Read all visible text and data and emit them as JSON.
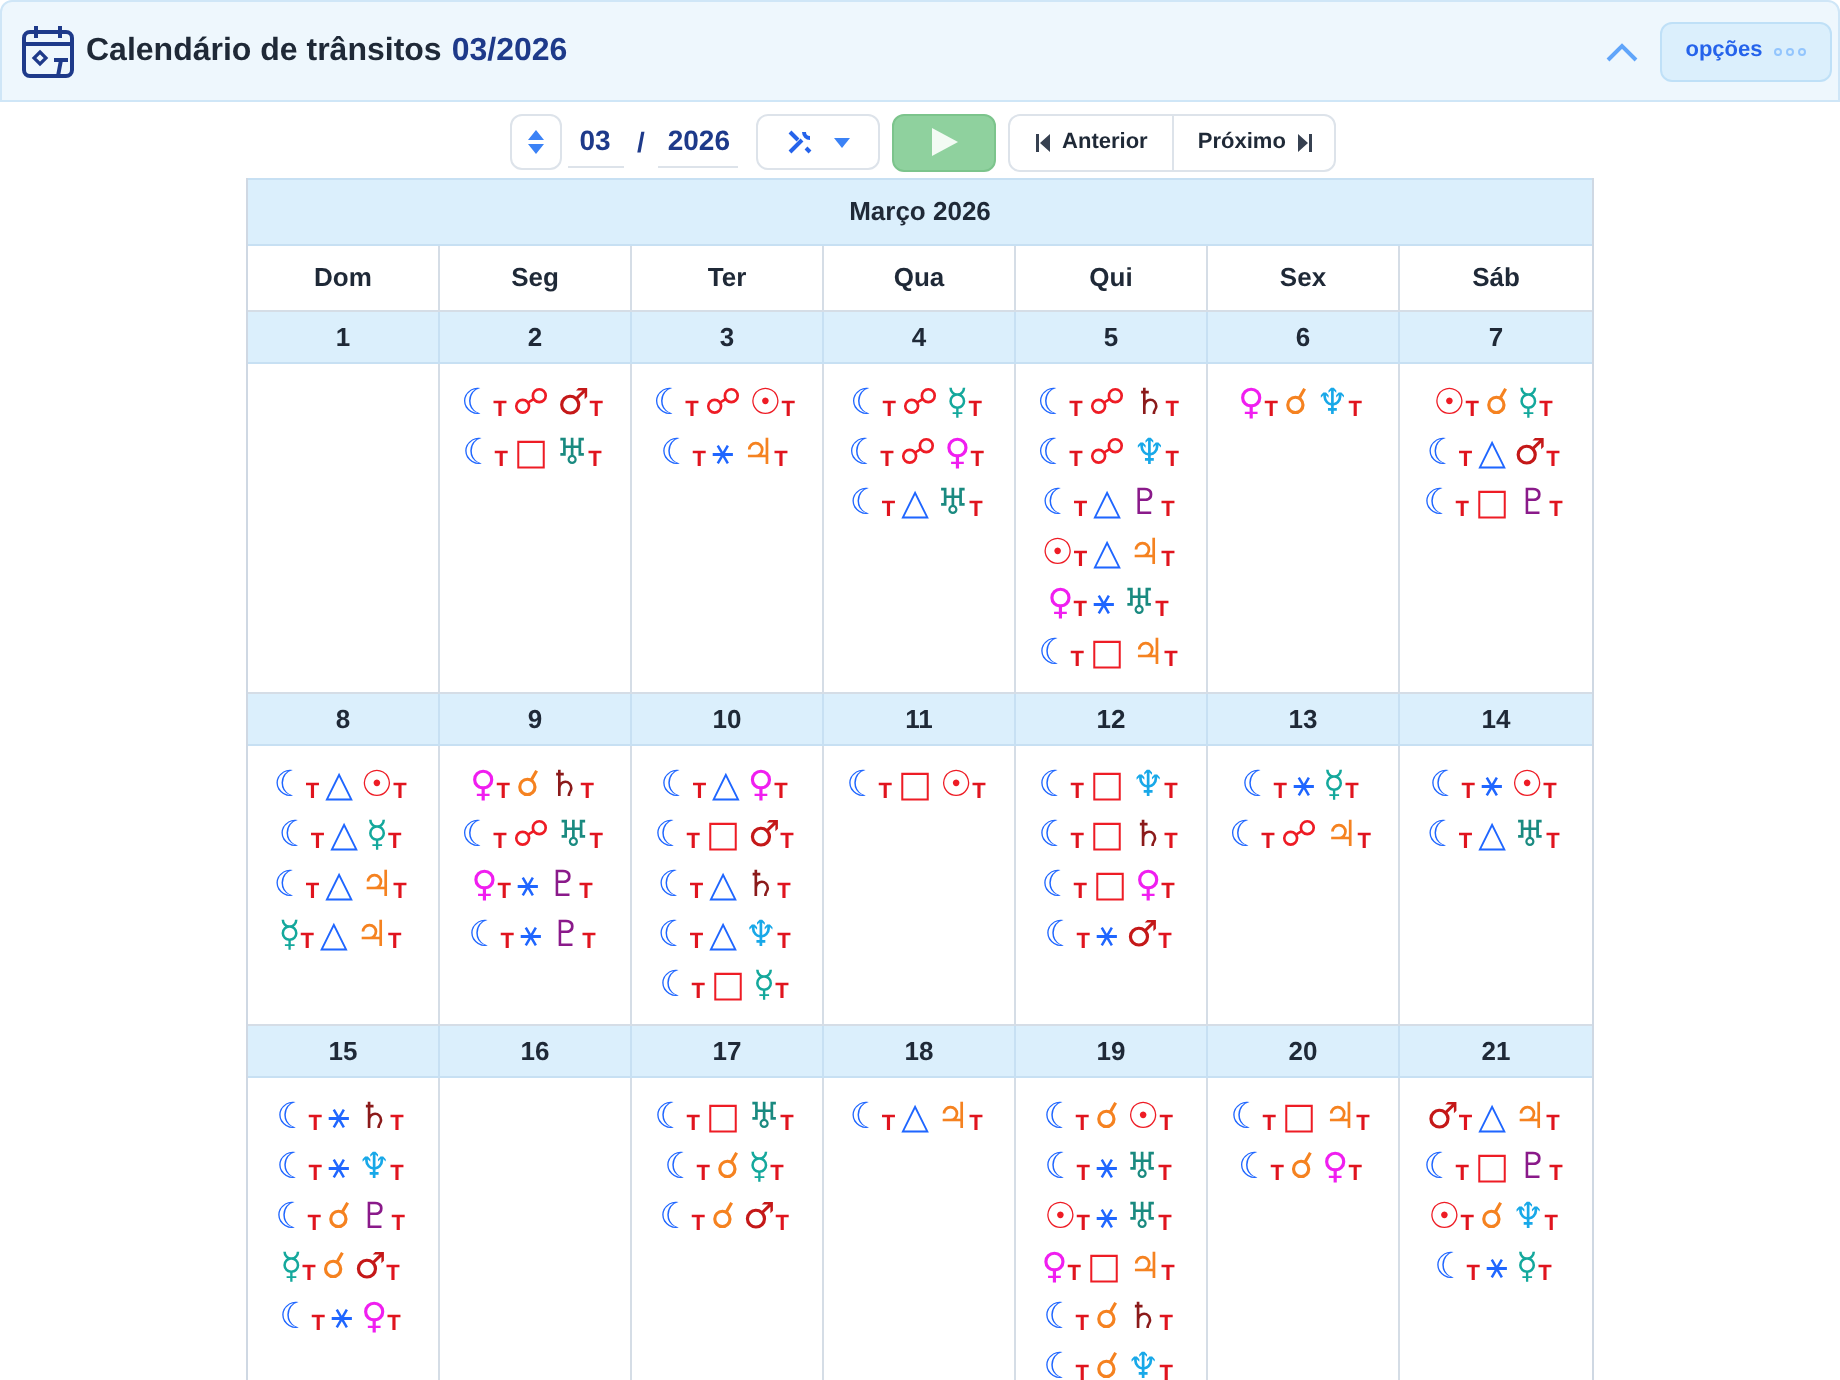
{
  "header": {
    "title": "Calendário de trânsitos",
    "period": "03/2026",
    "options": "opções"
  },
  "toolbar": {
    "month": "03",
    "separator": "/",
    "year": "2026",
    "previous": "Anterior",
    "next": "Próximo"
  },
  "calendar": {
    "title": "Março 2026",
    "weekdays": [
      "Dom",
      "Seg",
      "Ter",
      "Qua",
      "Qui",
      "Sex",
      "Sáb"
    ],
    "weeks": [
      {
        "days": [
          {
            "date": "1"
          },
          {
            "date": "2",
            "aspects": [
              {
                "from": {
                  "glyph": "☾",
                  "color": "#1f66ff"
                },
                "from_mark": "T",
                "aspect": {
                  "glyph": "☍",
                  "color": "#ee1c25"
                },
                "to": {
                  "glyph": "♂",
                  "color": "#c41818"
                },
                "to_mark": "T"
              },
              {
                "from": {
                  "glyph": "☾",
                  "color": "#1f66ff"
                },
                "from_mark": "T",
                "aspect": {
                  "glyph": "□",
                  "color": "#ee1c25"
                },
                "to": {
                  "glyph": "♅",
                  "color": "#1a8a80"
                },
                "to_mark": "T"
              }
            ]
          },
          {
            "date": "3",
            "aspects": [
              {
                "from": {
                  "glyph": "☾",
                  "color": "#1f66ff"
                },
                "from_mark": "T",
                "aspect": {
                  "glyph": "☍",
                  "color": "#ee1c25"
                },
                "to": {
                  "glyph": "☉",
                  "color": "#ee1c25"
                },
                "to_mark": "T"
              },
              {
                "from": {
                  "glyph": "☾",
                  "color": "#1f66ff"
                },
                "from_mark": "T",
                "aspect": {
                  "glyph": "⚹",
                  "color": "#1f66ff"
                },
                "to": {
                  "glyph": "♃",
                  "color": "#f58220"
                },
                "to_mark": "T"
              }
            ]
          },
          {
            "date": "4",
            "aspects": [
              {
                "from": {
                  "glyph": "☾",
                  "color": "#1f66ff"
                },
                "from_mark": "T",
                "aspect": {
                  "glyph": "☍",
                  "color": "#ee1c25"
                },
                "to": {
                  "glyph": "☿",
                  "color": "#14a89c"
                },
                "to_mark": "T"
              },
              {
                "from": {
                  "glyph": "☾",
                  "color": "#1f66ff"
                },
                "from_mark": "T",
                "aspect": {
                  "glyph": "☍",
                  "color": "#ee1c25"
                },
                "to": {
                  "glyph": "♀",
                  "color": "#f01ef0"
                },
                "to_mark": "T"
              },
              {
                "from": {
                  "glyph": "☾",
                  "color": "#1f66ff"
                },
                "from_mark": "T",
                "aspect": {
                  "glyph": "△",
                  "color": "#1f66ff"
                },
                "to": {
                  "glyph": "♅",
                  "color": "#1a8a80"
                },
                "to_mark": "T"
              }
            ]
          },
          {
            "date": "5",
            "aspects": [
              {
                "from": {
                  "glyph": "☾",
                  "color": "#1f66ff"
                },
                "from_mark": "T",
                "aspect": {
                  "glyph": "☍",
                  "color": "#ee1c25"
                },
                "to": {
                  "glyph": "♄",
                  "color": "#8b1a1a"
                },
                "to_mark": "T"
              },
              {
                "from": {
                  "glyph": "☾",
                  "color": "#1f66ff"
                },
                "from_mark": "T",
                "aspect": {
                  "glyph": "☍",
                  "color": "#ee1c25"
                },
                "to": {
                  "glyph": "♆",
                  "color": "#18a8e8"
                },
                "to_mark": "T"
              },
              {
                "from": {
                  "glyph": "☾",
                  "color": "#1f66ff"
                },
                "from_mark": "T",
                "aspect": {
                  "glyph": "△",
                  "color": "#1f66ff"
                },
                "to": {
                  "glyph": "♇",
                  "color": "#8a1a8a"
                },
                "to_mark": "T"
              },
              {
                "from": {
                  "glyph": "☉",
                  "color": "#ee1c25"
                },
                "from_mark": "T",
                "aspect": {
                  "glyph": "△",
                  "color": "#1f66ff"
                },
                "to": {
                  "glyph": "♃",
                  "color": "#f58220"
                },
                "to_mark": "T"
              },
              {
                "from": {
                  "glyph": "♀",
                  "color": "#f01ef0"
                },
                "from_mark": "T",
                "aspect": {
                  "glyph": "⚹",
                  "color": "#1f66ff"
                },
                "to": {
                  "glyph": "♅",
                  "color": "#1a8a80"
                },
                "to_mark": "T"
              },
              {
                "from": {
                  "glyph": "☾",
                  "color": "#1f66ff"
                },
                "from_mark": "T",
                "aspect": {
                  "glyph": "□",
                  "color": "#ee1c25"
                },
                "to": {
                  "glyph": "♃",
                  "color": "#f58220"
                },
                "to_mark": "T"
              }
            ]
          },
          {
            "date": "6",
            "aspects": [
              {
                "from": {
                  "glyph": "♀",
                  "color": "#f01ef0"
                },
                "from_mark": "T",
                "aspect": {
                  "glyph": "☌",
                  "color": "#f58220"
                },
                "to": {
                  "glyph": "♆",
                  "color": "#18a8e8"
                },
                "to_mark": "T"
              }
            ]
          },
          {
            "date": "7",
            "aspects": [
              {
                "from": {
                  "glyph": "☉",
                  "color": "#ee1c25"
                },
                "from_mark": "T",
                "aspect": {
                  "glyph": "☌",
                  "color": "#f58220"
                },
                "to": {
                  "glyph": "☿",
                  "color": "#14a89c"
                },
                "to_mark": "T"
              },
              {
                "from": {
                  "glyph": "☾",
                  "color": "#1f66ff"
                },
                "from_mark": "T",
                "aspect": {
                  "glyph": "△",
                  "color": "#1f66ff"
                },
                "to": {
                  "glyph": "♂",
                  "color": "#c41818"
                },
                "to_mark": "T"
              },
              {
                "from": {
                  "glyph": "☾",
                  "color": "#1f66ff"
                },
                "from_mark": "T",
                "aspect": {
                  "glyph": "□",
                  "color": "#ee1c25"
                },
                "to": {
                  "glyph": "♇",
                  "color": "#8a1a8a"
                },
                "to_mark": "T"
              }
            ]
          }
        ]
      },
      {
        "days": [
          {
            "date": "8",
            "aspects": [
              {
                "from": {
                  "glyph": "☾",
                  "color": "#1f66ff"
                },
                "from_mark": "T",
                "aspect": {
                  "glyph": "△",
                  "color": "#1f66ff"
                },
                "to": {
                  "glyph": "☉",
                  "color": "#ee1c25"
                },
                "to_mark": "T"
              },
              {
                "from": {
                  "glyph": "☾",
                  "color": "#1f66ff"
                },
                "from_mark": "T",
                "aspect": {
                  "glyph": "△",
                  "color": "#1f66ff"
                },
                "to": {
                  "glyph": "☿",
                  "color": "#14a89c"
                },
                "to_mark": "T"
              },
              {
                "from": {
                  "glyph": "☾",
                  "color": "#1f66ff"
                },
                "from_mark": "T",
                "aspect": {
                  "glyph": "△",
                  "color": "#1f66ff"
                },
                "to": {
                  "glyph": "♃",
                  "color": "#f58220"
                },
                "to_mark": "T"
              },
              {
                "from": {
                  "glyph": "☿",
                  "color": "#14a89c"
                },
                "from_mark": "T",
                "aspect": {
                  "glyph": "△",
                  "color": "#1f66ff"
                },
                "to": {
                  "glyph": "♃",
                  "color": "#f58220"
                },
                "to_mark": "T"
              }
            ]
          },
          {
            "date": "9",
            "aspects": [
              {
                "from": {
                  "glyph": "♀",
                  "color": "#f01ef0"
                },
                "from_mark": "T",
                "aspect": {
                  "glyph": "☌",
                  "color": "#f58220"
                },
                "to": {
                  "glyph": "♄",
                  "color": "#8b1a1a"
                },
                "to_mark": "T"
              },
              {
                "from": {
                  "glyph": "☾",
                  "color": "#1f66ff"
                },
                "from_mark": "T",
                "aspect": {
                  "glyph": "☍",
                  "color": "#ee1c25"
                },
                "to": {
                  "glyph": "♅",
                  "color": "#1a8a80"
                },
                "to_mark": "T"
              },
              {
                "from": {
                  "glyph": "♀",
                  "color": "#f01ef0"
                },
                "from_mark": "T",
                "aspect": {
                  "glyph": "⚹",
                  "color": "#1f66ff"
                },
                "to": {
                  "glyph": "♇",
                  "color": "#8a1a8a"
                },
                "to_mark": "T"
              },
              {
                "from": {
                  "glyph": "☾",
                  "color": "#1f66ff"
                },
                "from_mark": "T",
                "aspect": {
                  "glyph": "⚹",
                  "color": "#1f66ff"
                },
                "to": {
                  "glyph": "♇",
                  "color": "#8a1a8a"
                },
                "to_mark": "T"
              }
            ]
          },
          {
            "date": "10",
            "aspects": [
              {
                "from": {
                  "glyph": "☾",
                  "color": "#1f66ff"
                },
                "from_mark": "T",
                "aspect": {
                  "glyph": "△",
                  "color": "#1f66ff"
                },
                "to": {
                  "glyph": "♀",
                  "color": "#f01ef0"
                },
                "to_mark": "T"
              },
              {
                "from": {
                  "glyph": "☾",
                  "color": "#1f66ff"
                },
                "from_mark": "T",
                "aspect": {
                  "glyph": "□",
                  "color": "#ee1c25"
                },
                "to": {
                  "glyph": "♂",
                  "color": "#c41818"
                },
                "to_mark": "T"
              },
              {
                "from": {
                  "glyph": "☾",
                  "color": "#1f66ff"
                },
                "from_mark": "T",
                "aspect": {
                  "glyph": "△",
                  "color": "#1f66ff"
                },
                "to": {
                  "glyph": "♄",
                  "color": "#8b1a1a"
                },
                "to_mark": "T"
              },
              {
                "from": {
                  "glyph": "☾",
                  "color": "#1f66ff"
                },
                "from_mark": "T",
                "aspect": {
                  "glyph": "△",
                  "color": "#1f66ff"
                },
                "to": {
                  "glyph": "♆",
                  "color": "#18a8e8"
                },
                "to_mark": "T"
              },
              {
                "from": {
                  "glyph": "☾",
                  "color": "#1f66ff"
                },
                "from_mark": "T",
                "aspect": {
                  "glyph": "□",
                  "color": "#ee1c25"
                },
                "to": {
                  "glyph": "☿",
                  "color": "#14a89c"
                },
                "to_mark": "T"
              }
            ]
          },
          {
            "date": "11",
            "aspects": [
              {
                "from": {
                  "glyph": "☾",
                  "color": "#1f66ff"
                },
                "from_mark": "T",
                "aspect": {
                  "glyph": "□",
                  "color": "#ee1c25"
                },
                "to": {
                  "glyph": "☉",
                  "color": "#ee1c25"
                },
                "to_mark": "T"
              }
            ]
          },
          {
            "date": "12",
            "aspects": [
              {
                "from": {
                  "glyph": "☾",
                  "color": "#1f66ff"
                },
                "from_mark": "T",
                "aspect": {
                  "glyph": "□",
                  "color": "#ee1c25"
                },
                "to": {
                  "glyph": "♆",
                  "color": "#18a8e8"
                },
                "to_mark": "T"
              },
              {
                "from": {
                  "glyph": "☾",
                  "color": "#1f66ff"
                },
                "from_mark": "T",
                "aspect": {
                  "glyph": "□",
                  "color": "#ee1c25"
                },
                "to": {
                  "glyph": "♄",
                  "color": "#8b1a1a"
                },
                "to_mark": "T"
              },
              {
                "from": {
                  "glyph": "☾",
                  "color": "#1f66ff"
                },
                "from_mark": "T",
                "aspect": {
                  "glyph": "□",
                  "color": "#ee1c25"
                },
                "to": {
                  "glyph": "♀",
                  "color": "#f01ef0"
                },
                "to_mark": "T"
              },
              {
                "from": {
                  "glyph": "☾",
                  "color": "#1f66ff"
                },
                "from_mark": "T",
                "aspect": {
                  "glyph": "⚹",
                  "color": "#1f66ff"
                },
                "to": {
                  "glyph": "♂",
                  "color": "#c41818"
                },
                "to_mark": "T"
              }
            ]
          },
          {
            "date": "13",
            "aspects": [
              {
                "from": {
                  "glyph": "☾",
                  "color": "#1f66ff"
                },
                "from_mark": "T",
                "aspect": {
                  "glyph": "⚹",
                  "color": "#1f66ff"
                },
                "to": {
                  "glyph": "☿",
                  "color": "#14a89c"
                },
                "to_mark": "T"
              },
              {
                "from": {
                  "glyph": "☾",
                  "color": "#1f66ff"
                },
                "from_mark": "T",
                "aspect": {
                  "glyph": "☍",
                  "color": "#ee1c25"
                },
                "to": {
                  "glyph": "♃",
                  "color": "#f58220"
                },
                "to_mark": "T"
              }
            ]
          },
          {
            "date": "14",
            "aspects": [
              {
                "from": {
                  "glyph": "☾",
                  "color": "#1f66ff"
                },
                "from_mark": "T",
                "aspect": {
                  "glyph": "⚹",
                  "color": "#1f66ff"
                },
                "to": {
                  "glyph": "☉",
                  "color": "#ee1c25"
                },
                "to_mark": "T"
              },
              {
                "from": {
                  "glyph": "☾",
                  "color": "#1f66ff"
                },
                "from_mark": "T",
                "aspect": {
                  "glyph": "△",
                  "color": "#1f66ff"
                },
                "to": {
                  "glyph": "♅",
                  "color": "#1a8a80"
                },
                "to_mark": "T"
              }
            ]
          }
        ]
      },
      {
        "days": [
          {
            "date": "15",
            "aspects": [
              {
                "from": {
                  "glyph": "☾",
                  "color": "#1f66ff"
                },
                "from_mark": "T",
                "aspect": {
                  "glyph": "⚹",
                  "color": "#1f66ff"
                },
                "to": {
                  "glyph": "♄",
                  "color": "#8b1a1a"
                },
                "to_mark": "T"
              },
              {
                "from": {
                  "glyph": "☾",
                  "color": "#1f66ff"
                },
                "from_mark": "T",
                "aspect": {
                  "glyph": "⚹",
                  "color": "#1f66ff"
                },
                "to": {
                  "glyph": "♆",
                  "color": "#18a8e8"
                },
                "to_mark": "T"
              },
              {
                "from": {
                  "glyph": "☾",
                  "color": "#1f66ff"
                },
                "from_mark": "T",
                "aspect": {
                  "glyph": "☌",
                  "color": "#f58220"
                },
                "to": {
                  "glyph": "♇",
                  "color": "#8a1a8a"
                },
                "to_mark": "T"
              },
              {
                "from": {
                  "glyph": "☿",
                  "color": "#14a89c"
                },
                "from_mark": "T",
                "aspect": {
                  "glyph": "☌",
                  "color": "#f58220"
                },
                "to": {
                  "glyph": "♂",
                  "color": "#c41818"
                },
                "to_mark": "T"
              },
              {
                "from": {
                  "glyph": "☾",
                  "color": "#1f66ff"
                },
                "from_mark": "T",
                "aspect": {
                  "glyph": "⚹",
                  "color": "#1f66ff"
                },
                "to": {
                  "glyph": "♀",
                  "color": "#f01ef0"
                },
                "to_mark": "T"
              }
            ]
          },
          {
            "date": "16"
          },
          {
            "date": "17",
            "aspects": [
              {
                "from": {
                  "glyph": "☾",
                  "color": "#1f66ff"
                },
                "from_mark": "T",
                "aspect": {
                  "glyph": "□",
                  "color": "#ee1c25"
                },
                "to": {
                  "glyph": "♅",
                  "color": "#1a8a80"
                },
                "to_mark": "T"
              },
              {
                "from": {
                  "glyph": "☾",
                  "color": "#1f66ff"
                },
                "from_mark": "T",
                "aspect": {
                  "glyph": "☌",
                  "color": "#f58220"
                },
                "to": {
                  "glyph": "☿",
                  "color": "#14a89c"
                },
                "to_mark": "T"
              },
              {
                "from": {
                  "glyph": "☾",
                  "color": "#1f66ff"
                },
                "from_mark": "T",
                "aspect": {
                  "glyph": "☌",
                  "color": "#f58220"
                },
                "to": {
                  "glyph": "♂",
                  "color": "#c41818"
                },
                "to_mark": "T"
              }
            ]
          },
          {
            "date": "18",
            "aspects": [
              {
                "from": {
                  "glyph": "☾",
                  "color": "#1f66ff"
                },
                "from_mark": "T",
                "aspect": {
                  "glyph": "△",
                  "color": "#1f66ff"
                },
                "to": {
                  "glyph": "♃",
                  "color": "#f58220"
                },
                "to_mark": "T"
              }
            ]
          },
          {
            "date": "19",
            "aspects": [
              {
                "from": {
                  "glyph": "☾",
                  "color": "#1f66ff"
                },
                "from_mark": "T",
                "aspect": {
                  "glyph": "☌",
                  "color": "#f58220"
                },
                "to": {
                  "glyph": "☉",
                  "color": "#ee1c25"
                },
                "to_mark": "T"
              },
              {
                "from": {
                  "glyph": "☾",
                  "color": "#1f66ff"
                },
                "from_mark": "T",
                "aspect": {
                  "glyph": "⚹",
                  "color": "#1f66ff"
                },
                "to": {
                  "glyph": "♅",
                  "color": "#1a8a80"
                },
                "to_mark": "T"
              },
              {
                "from": {
                  "glyph": "☉",
                  "color": "#ee1c25"
                },
                "from_mark": "T",
                "aspect": {
                  "glyph": "⚹",
                  "color": "#1f66ff"
                },
                "to": {
                  "glyph": "♅",
                  "color": "#1a8a80"
                },
                "to_mark": "T"
              },
              {
                "from": {
                  "glyph": "♀",
                  "color": "#f01ef0"
                },
                "from_mark": "T",
                "aspect": {
                  "glyph": "□",
                  "color": "#ee1c25"
                },
                "to": {
                  "glyph": "♃",
                  "color": "#f58220"
                },
                "to_mark": "T"
              },
              {
                "from": {
                  "glyph": "☾",
                  "color": "#1f66ff"
                },
                "from_mark": "T",
                "aspect": {
                  "glyph": "☌",
                  "color": "#f58220"
                },
                "to": {
                  "glyph": "♄",
                  "color": "#8b1a1a"
                },
                "to_mark": "T"
              },
              {
                "from": {
                  "glyph": "☾",
                  "color": "#1f66ff"
                },
                "from_mark": "T",
                "aspect": {
                  "glyph": "☌",
                  "color": "#f58220"
                },
                "to": {
                  "glyph": "♆",
                  "color": "#18a8e8"
                },
                "to_mark": "T"
              }
            ]
          },
          {
            "date": "20",
            "aspects": [
              {
                "from": {
                  "glyph": "☾",
                  "color": "#1f66ff"
                },
                "from_mark": "T",
                "aspect": {
                  "glyph": "□",
                  "color": "#ee1c25"
                },
                "to": {
                  "glyph": "♃",
                  "color": "#f58220"
                },
                "to_mark": "T"
              },
              {
                "from": {
                  "glyph": "☾",
                  "color": "#1f66ff"
                },
                "from_mark": "T",
                "aspect": {
                  "glyph": "☌",
                  "color": "#f58220"
                },
                "to": {
                  "glyph": "♀",
                  "color": "#f01ef0"
                },
                "to_mark": "T"
              }
            ]
          },
          {
            "date": "21",
            "aspects": [
              {
                "from": {
                  "glyph": "♂",
                  "color": "#c41818"
                },
                "from_mark": "T",
                "aspect": {
                  "glyph": "△",
                  "color": "#1f66ff"
                },
                "to": {
                  "glyph": "♃",
                  "color": "#f58220"
                },
                "to_mark": "T"
              },
              {
                "from": {
                  "glyph": "☾",
                  "color": "#1f66ff"
                },
                "from_mark": "T",
                "aspect": {
                  "glyph": "□",
                  "color": "#ee1c25"
                },
                "to": {
                  "glyph": "♇",
                  "color": "#8a1a8a"
                },
                "to_mark": "T"
              },
              {
                "from": {
                  "glyph": "☉",
                  "color": "#ee1c25"
                },
                "from_mark": "T",
                "aspect": {
                  "glyph": "☌",
                  "color": "#f58220"
                },
                "to": {
                  "glyph": "♆",
                  "color": "#18a8e8"
                },
                "to_mark": "T"
              },
              {
                "from": {
                  "glyph": "☾",
                  "color": "#1f66ff"
                },
                "from_mark": "T",
                "aspect": {
                  "glyph": "⚹",
                  "color": "#1f66ff"
                },
                "to": {
                  "glyph": "☿",
                  "color": "#14a89c"
                },
                "to_mark": "T"
              }
            ]
          }
        ]
      }
    ]
  }
}
